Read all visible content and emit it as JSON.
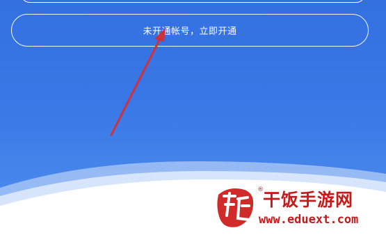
{
  "activate_prompt": {
    "label": "未开通帐号，立即开通"
  },
  "watermark": {
    "site_name": "干饭手游网",
    "url": "www.eduext.com",
    "logo_char": "饭",
    "registered_mark": "®"
  },
  "colors": {
    "background_top": "#3470e0",
    "background_bottom": "#5091ee",
    "annotation_arrow": "#d0303a",
    "watermark": "#c21b1b"
  },
  "icons": {
    "annotation": "red-arrow-icon",
    "logo": "fan-logo-icon"
  }
}
